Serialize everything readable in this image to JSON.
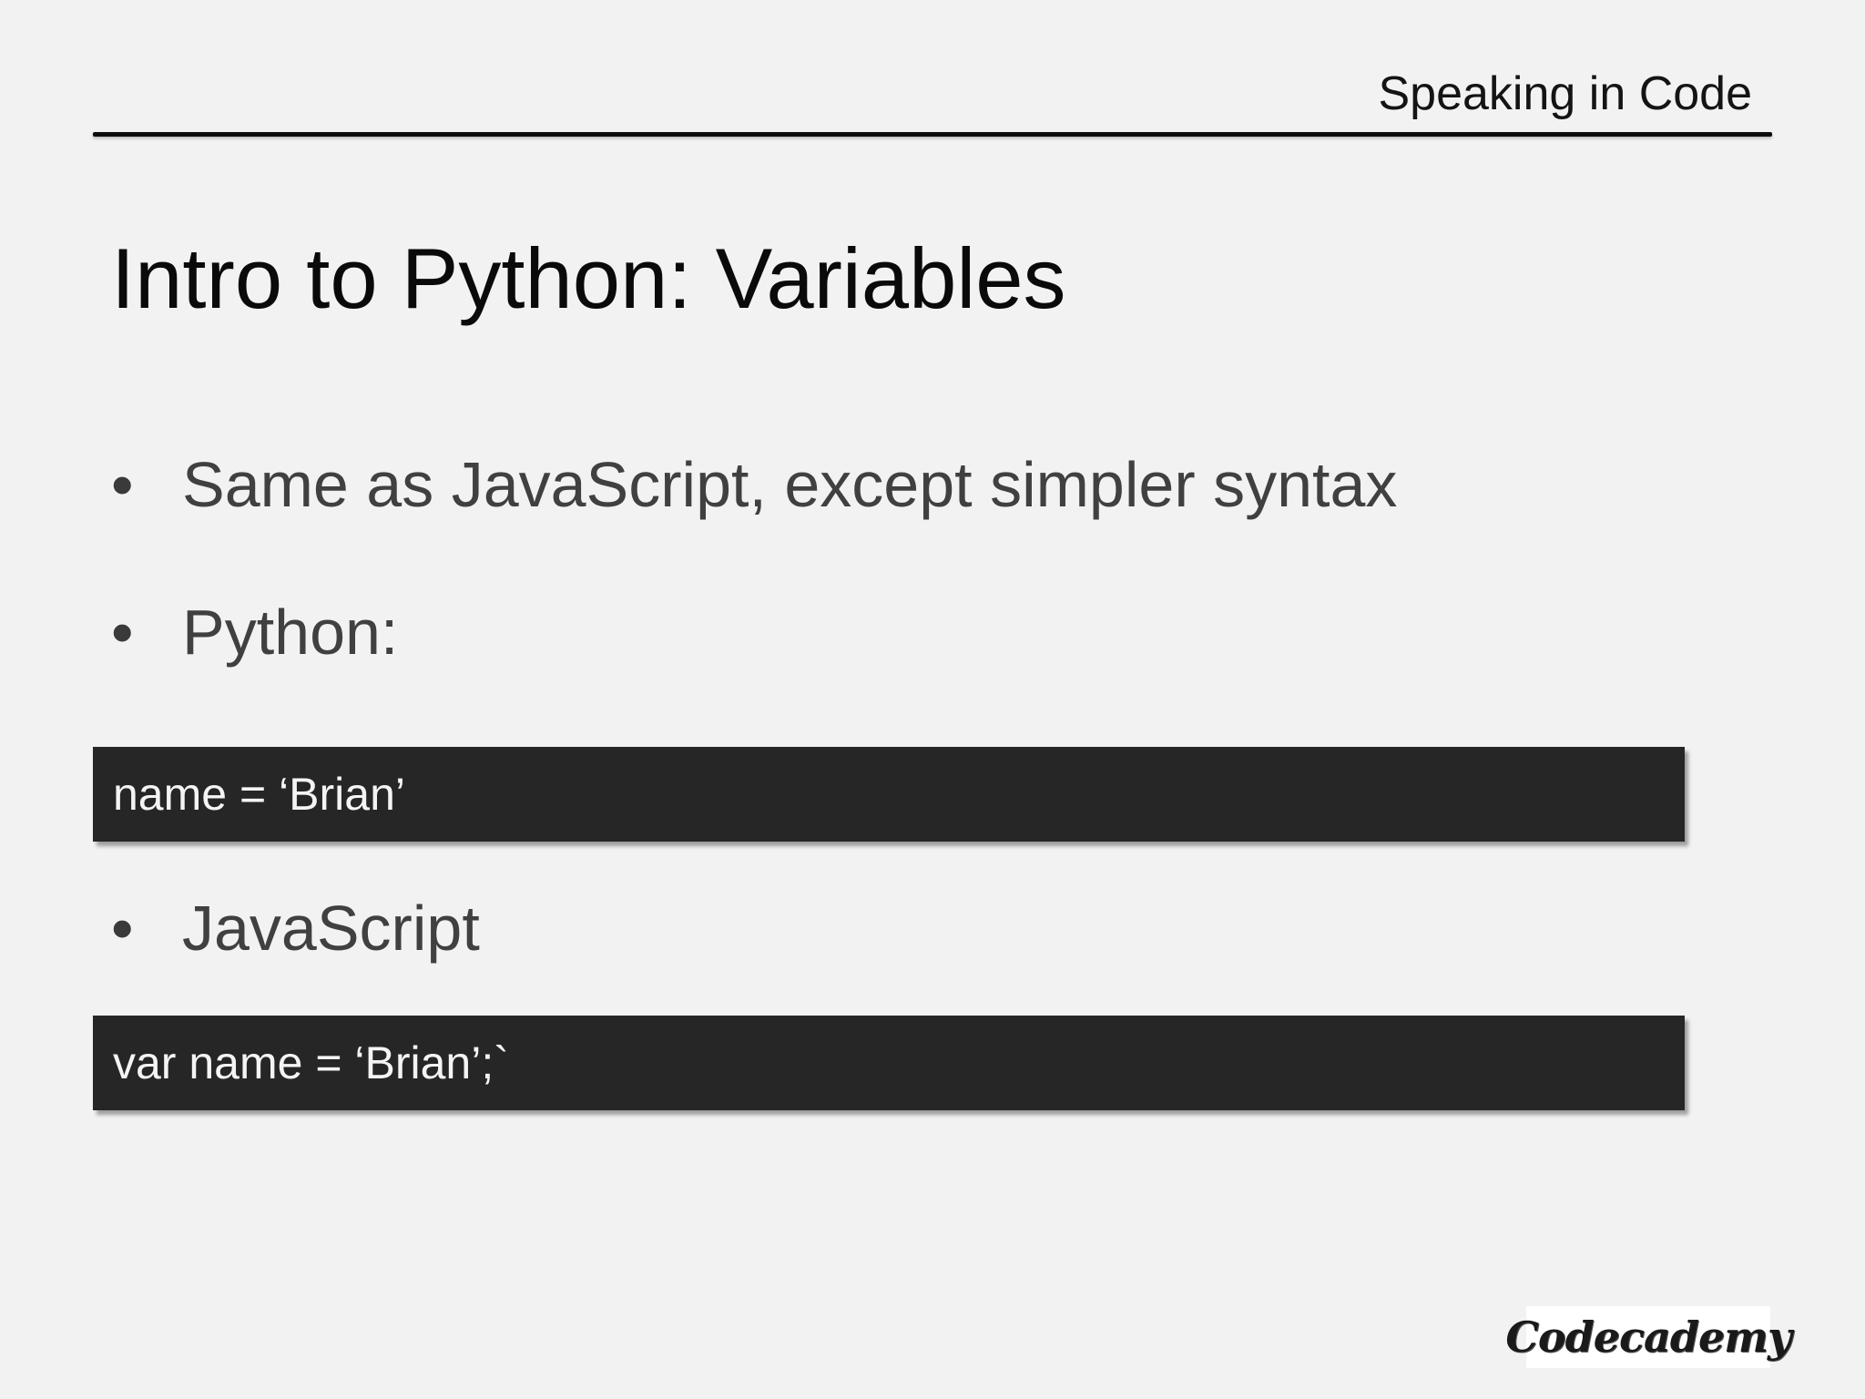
{
  "header": {
    "title": "Speaking in Code"
  },
  "slide": {
    "title": "Intro to Python: Variables",
    "bullets": [
      {
        "marker": "•",
        "text": "Same as JavaScript, except simpler syntax"
      },
      {
        "marker": "•",
        "text": "Python:"
      },
      {
        "marker": "•",
        "text": "JavaScript"
      }
    ],
    "code_blocks": [
      {
        "code": "name = ‘Brian’"
      },
      {
        "code": "var name = ‘Brian’;`"
      }
    ]
  },
  "footer": {
    "logo_text": "Codecademy"
  },
  "colors": {
    "background": "#f2f2f3",
    "code_background": "#262627",
    "code_text": "#f4f4f4",
    "bullet_text": "#404040"
  }
}
